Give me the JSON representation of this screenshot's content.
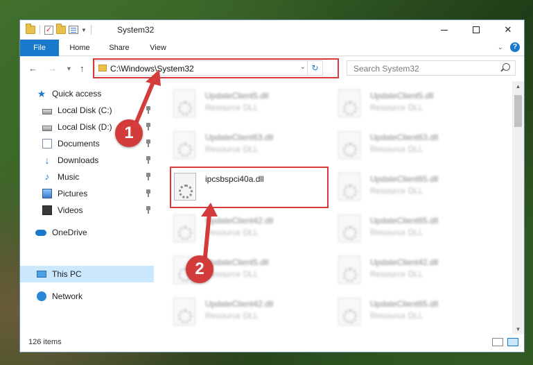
{
  "window": {
    "title": "System32"
  },
  "ribbon": {
    "tabs": [
      "File",
      "Home",
      "Share",
      "View"
    ]
  },
  "address": {
    "path": "C:\\Windows\\System32"
  },
  "search": {
    "placeholder": "Search System32"
  },
  "nav": {
    "items": [
      {
        "label": "Quick access",
        "icon": "star-icon"
      },
      {
        "label": "Local Disk (C:)",
        "icon": "disk-icon",
        "pinned": true
      },
      {
        "label": "Local Disk (D:)",
        "icon": "disk-icon",
        "pinned": true
      },
      {
        "label": "Documents",
        "icon": "documents-icon",
        "pinned": true
      },
      {
        "label": "Downloads",
        "icon": "downloads-icon",
        "pinned": true
      },
      {
        "label": "Music",
        "icon": "music-icon",
        "pinned": true
      },
      {
        "label": "Pictures",
        "icon": "pictures-icon",
        "pinned": true
      },
      {
        "label": "Videos",
        "icon": "videos-icon",
        "pinned": true
      },
      {
        "label": "OneDrive",
        "icon": "onedrive-icon"
      },
      {
        "label": "This PC",
        "icon": "this-pc-icon",
        "selected": true
      },
      {
        "label": "Network",
        "icon": "network-icon"
      }
    ]
  },
  "files": [
    {
      "name": "UpdateClient5.dll",
      "desc": "Resource DLL"
    },
    {
      "name": "UpdateClient5.dll",
      "desc": "Resource DLL"
    },
    {
      "name": "UpdateClient63.dll",
      "desc": "Resource DLL"
    },
    {
      "name": "UpdateClient63.dll",
      "desc": "Resource DLL"
    },
    {
      "name": "ipcsbspci40a.dll",
      "desc": ""
    },
    {
      "name": "UpdateClient65.dll",
      "desc": "Resource DLL"
    },
    {
      "name": "UpdateClient42.dll",
      "desc": "Resource DLL"
    },
    {
      "name": "UpdateClient65.dll",
      "desc": "Resource DLL"
    },
    {
      "name": "UpdateClient5.dll",
      "desc": "Resource DLL"
    },
    {
      "name": "UpdateClient42.dll",
      "desc": "Resource DLL"
    },
    {
      "name": "UpdateClient42.dll",
      "desc": "Resource DLL"
    },
    {
      "name": "UpdateClient65.dll",
      "desc": "Resource DLL"
    }
  ],
  "status": {
    "count": "126 items"
  },
  "annotations": {
    "callout_1": "1",
    "callout_2": "2"
  },
  "colors": {
    "accent": "#1979ca",
    "annotation": "#d8383a"
  }
}
